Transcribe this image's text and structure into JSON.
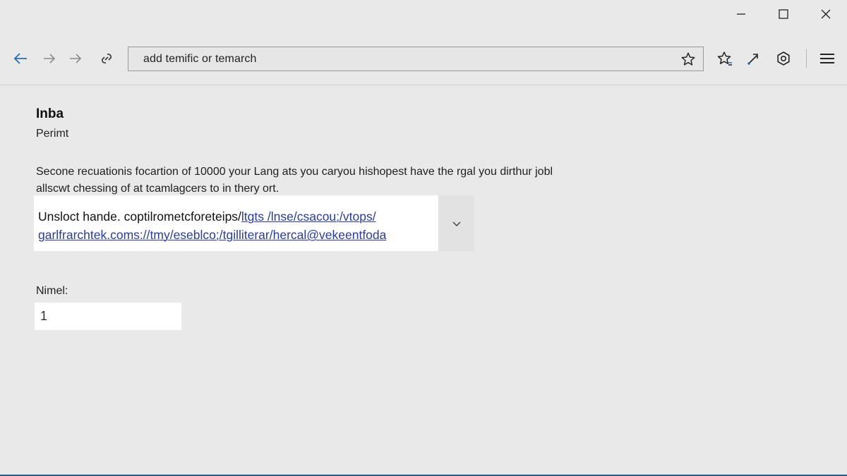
{
  "window_controls": {
    "minimize_icon": "minimize-icon",
    "maximize_icon": "maximize-icon",
    "close_icon": "close-icon"
  },
  "toolbar": {
    "back_icon": "back-arrow-icon",
    "forward_icon": "forward-arrow-icon",
    "forward2_icon": "forward-arrow-icon",
    "refresh_icon": "link-icon",
    "address": "add temific or temarch",
    "favorite_icon": "star-icon",
    "favorites_icon": "favorites-icon",
    "share_icon": "share-icon",
    "extension_icon": "extension-icon",
    "menu_icon": "menu-icon",
    "accent_color": "#2b6cb0"
  },
  "content": {
    "heading": "Inba",
    "subheading": "Perimt",
    "paragraph_line1": "Secone recuationis focartion of 10000 your Lang ats you caryou hishopest have the rgal you dirthur jobl",
    "paragraph_line2": "allscwt chessing of at tcamlagcers to in thery ort.",
    "dropdown": {
      "line1_plain": "Unsloct hande. coptilrometcforeteips/",
      "line1_link": "ltgts /lnse/csacou;/vtops/",
      "line2_link": "garlfrarchtek.coms://tmy/eseblco;/tgilliterar/hercal@vekeentfoda",
      "arrow_icon": "chevron-down-icon"
    },
    "field_label": "Nimel:",
    "field_value": "1"
  }
}
